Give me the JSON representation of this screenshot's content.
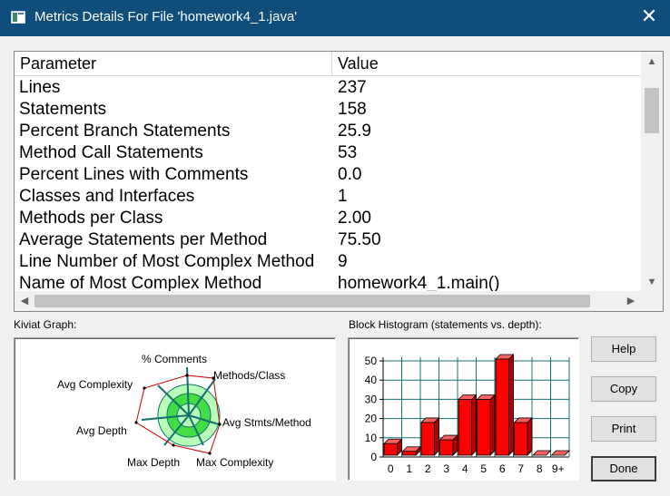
{
  "window": {
    "title": "Metrics Details For File 'homework4_1.java'",
    "close_glyph": "✕"
  },
  "metrics_table": {
    "columns": {
      "parameter": "Parameter",
      "value": "Value"
    },
    "rows": [
      {
        "parameter": "Lines",
        "value": "237"
      },
      {
        "parameter": "Statements",
        "value": "158"
      },
      {
        "parameter": "Percent Branch Statements",
        "value": "25.9"
      },
      {
        "parameter": "Method Call Statements",
        "value": "53"
      },
      {
        "parameter": "Percent Lines with Comments",
        "value": "0.0"
      },
      {
        "parameter": "Classes and Interfaces",
        "value": "1"
      },
      {
        "parameter": "Methods per Class",
        "value": "2.00"
      },
      {
        "parameter": "Average Statements per Method",
        "value": "75.50"
      },
      {
        "parameter": "Line Number of Most Complex Method",
        "value": "9"
      },
      {
        "parameter": "Name of Most Complex Method",
        "value": "homework4_1.main()"
      }
    ]
  },
  "kiviat": {
    "label": "Kiviat Graph:",
    "axes": [
      "% Comments",
      "Methods/Class",
      "Avg Stmts/Method",
      "Max Complexity",
      "Max Depth",
      "Avg Depth",
      "Avg Complexity"
    ],
    "ring_colors": {
      "outer": "#b8ffb8",
      "middle": "#44dd44",
      "inner": "#b8ffb8",
      "axis": "#107070",
      "polygon": "#cc0000"
    }
  },
  "histogram": {
    "label": "Block Histogram (statements vs. depth):",
    "chart_data": {
      "type": "bar",
      "categories": [
        "0",
        "1",
        "2",
        "3",
        "4",
        "5",
        "6",
        "7",
        "8",
        "9+"
      ],
      "values": [
        6,
        2,
        17,
        8,
        29,
        29,
        50,
        17,
        0,
        0
      ],
      "ylim": [
        0,
        50
      ],
      "yticks": [
        "0",
        "10",
        "20",
        "30",
        "40",
        "50"
      ],
      "grid": true,
      "bar_color": "#ff0000",
      "grid_color": "#107070"
    }
  },
  "buttons": {
    "help": "Help",
    "copy": "Copy",
    "print": "Print",
    "done": "Done"
  }
}
